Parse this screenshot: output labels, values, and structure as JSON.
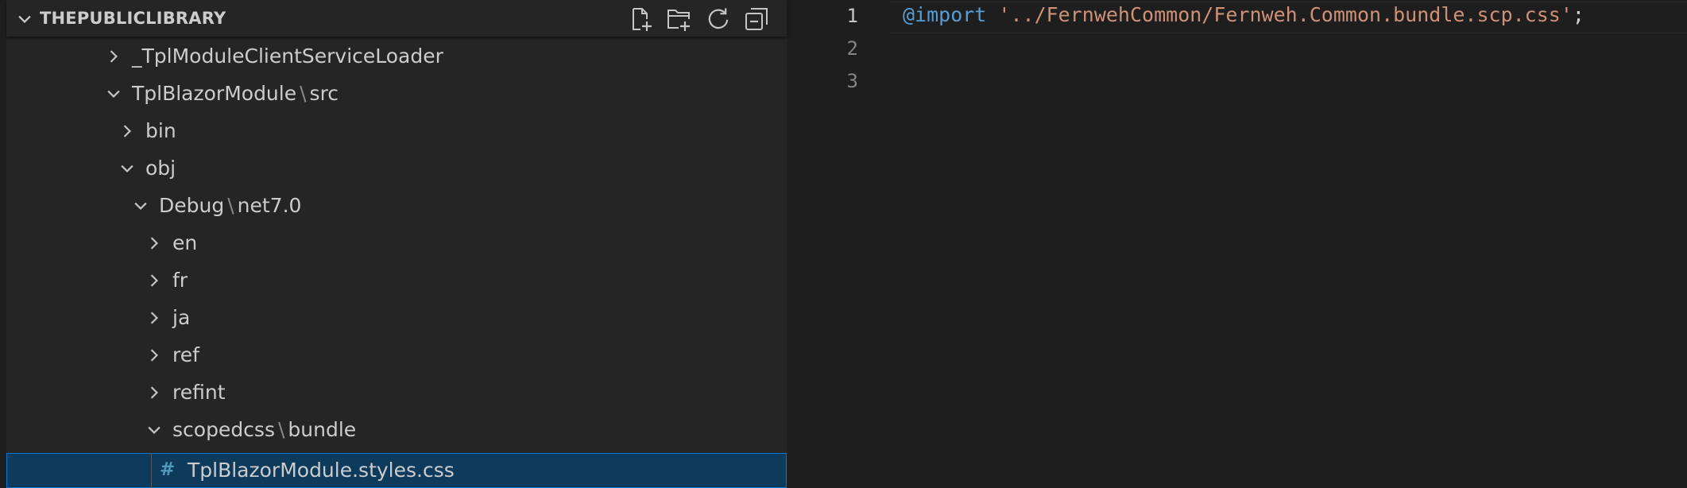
{
  "explorer": {
    "title": "THEPUBLICLIBRARY",
    "actions": [
      {
        "name": "new-file-icon",
        "label": "New File..."
      },
      {
        "name": "new-folder-icon",
        "label": "New Folder..."
      },
      {
        "name": "refresh-icon",
        "label": "Refresh Explorer"
      },
      {
        "name": "collapse-all-icon",
        "label": "Collapse Folders in Explorer"
      }
    ],
    "tree": [
      {
        "label": "_TplModuleClientServiceLoader",
        "expanded": false,
        "icon": "chevron-right-icon"
      },
      {
        "label": "TplBlazorModule",
        "suffix": "src",
        "expanded": true,
        "icon": "chevron-down-icon"
      },
      {
        "label": "bin",
        "expanded": false,
        "icon": "chevron-right-icon"
      },
      {
        "label": "obj",
        "expanded": true,
        "icon": "chevron-down-icon"
      },
      {
        "label": "Debug",
        "suffix": "net7.0",
        "expanded": true,
        "icon": "chevron-down-icon"
      },
      {
        "label": "en",
        "expanded": false,
        "icon": "chevron-right-icon"
      },
      {
        "label": "fr",
        "expanded": false,
        "icon": "chevron-right-icon"
      },
      {
        "label": "ja",
        "expanded": false,
        "icon": "chevron-right-icon"
      },
      {
        "label": "ref",
        "expanded": false,
        "icon": "chevron-right-icon"
      },
      {
        "label": "refint",
        "expanded": false,
        "icon": "chevron-right-icon"
      },
      {
        "label": "scopedcss",
        "suffix": "bundle",
        "expanded": true,
        "icon": "chevron-down-icon"
      },
      {
        "label": "TplBlazorModule.styles.css",
        "file": true,
        "file_glyph": "#",
        "selected": true,
        "icon": "css-file-icon"
      }
    ],
    "path_separator": "\\"
  },
  "editor": {
    "lines": [
      {
        "number": "1",
        "active": true,
        "tokens": [
          {
            "type": "keyword",
            "text": "@import"
          },
          {
            "type": "punct",
            "text": " "
          },
          {
            "type": "string",
            "text": "'../FernwehCommon/Fernweh.Common.bundle.scp.css'"
          },
          {
            "type": "punct",
            "text": ";"
          }
        ]
      },
      {
        "number": "2",
        "active": false,
        "tokens": []
      },
      {
        "number": "3",
        "active": false,
        "tokens": []
      }
    ]
  },
  "colors": {
    "sidebar_bg": "#252526",
    "editor_bg": "#1e1e1e",
    "selection_bg": "#0e3a5c",
    "focus_border": "#0078d4",
    "keyword": "#569cd6",
    "string": "#ce9178",
    "css_icon": "#519aba"
  }
}
